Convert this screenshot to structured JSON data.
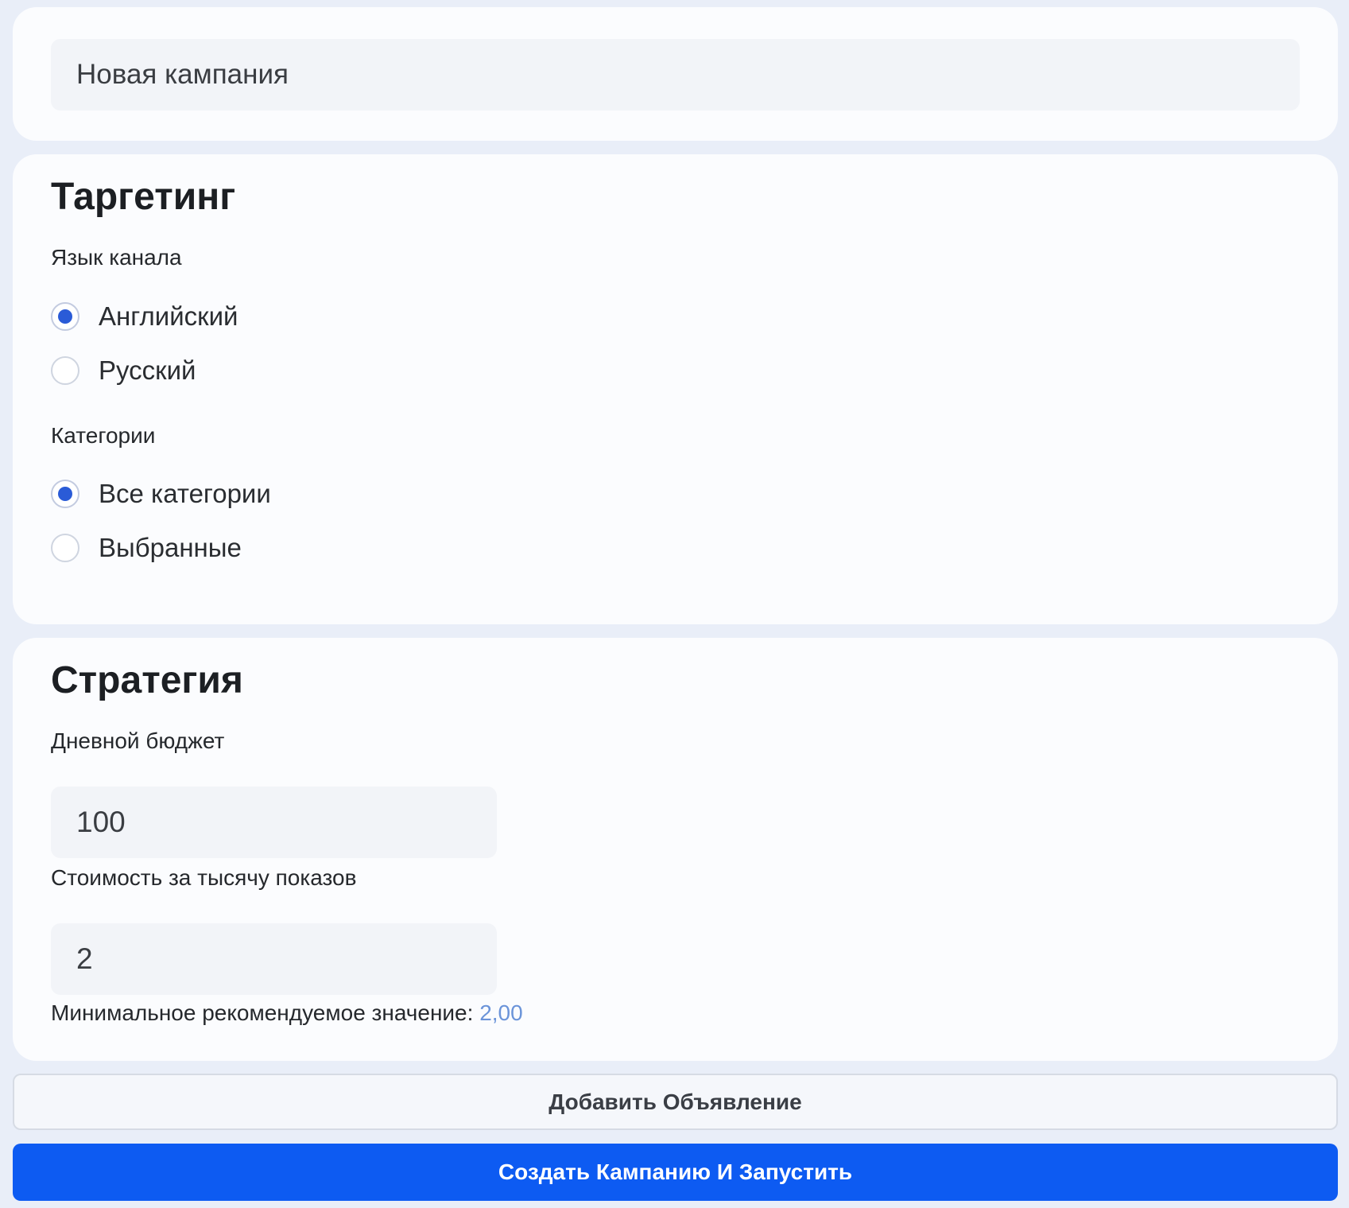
{
  "campaign": {
    "name_value": "Новая кампания"
  },
  "targeting": {
    "title": "Таргетинг",
    "language": {
      "label": "Язык канала",
      "options": [
        {
          "label": "Английский",
          "checked": true
        },
        {
          "label": "Русский",
          "checked": false
        }
      ]
    },
    "categories": {
      "label": "Категории",
      "options": [
        {
          "label": "Все категории",
          "checked": true
        },
        {
          "label": "Выбранные",
          "checked": false
        }
      ]
    }
  },
  "strategy": {
    "title": "Стратегия",
    "daily_budget": {
      "label": "Дневной бюджет",
      "value": "100"
    },
    "cpm": {
      "label": "Стоимость за тысячу показов",
      "value": "2"
    },
    "hint": {
      "text": "Минимальное рекомендуемое значение: ",
      "value": "2,00"
    }
  },
  "actions": {
    "add_ad_label": "Добавить Объявление",
    "create_launch_label": "Создать Кампанию И Запустить"
  },
  "colors": {
    "primary": "#0d5bf2",
    "radio_checked": "#2a5bd7",
    "hint_value": "#6b94d9"
  }
}
